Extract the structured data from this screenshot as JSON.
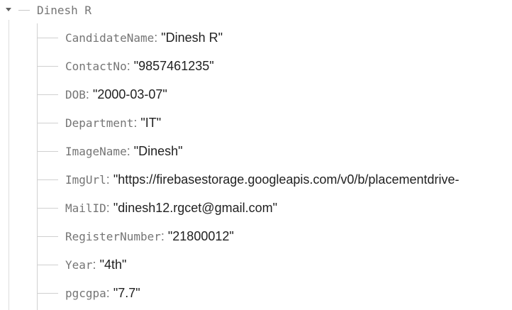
{
  "root": {
    "key": "Dinesh R"
  },
  "fields": [
    {
      "key": "CandidateName",
      "value": "\"Dinesh R\""
    },
    {
      "key": "ContactNo",
      "value": "\"9857461235\""
    },
    {
      "key": "DOB",
      "value": "\"2000-03-07\""
    },
    {
      "key": "Department",
      "value": "\"IT\""
    },
    {
      "key": "ImageName",
      "value": "\"Dinesh\""
    },
    {
      "key": "ImgUrl",
      "value": "\"https://firebasestorage.googleapis.com/v0/b/placementdrive-"
    },
    {
      "key": "MailID",
      "value": "\"dinesh12.rgcet@gmail.com\""
    },
    {
      "key": "RegisterNumber",
      "value": "\"21800012\""
    },
    {
      "key": "Year",
      "value": "\"4th\""
    },
    {
      "key": "pgcgpa",
      "value": "\"7.7\""
    }
  ],
  "separator": ":",
  "colors": {
    "key": "#757575",
    "value": "#212121",
    "guide_line": "#d0d0d0"
  },
  "icons": {
    "toggle": "caret-down-icon"
  }
}
